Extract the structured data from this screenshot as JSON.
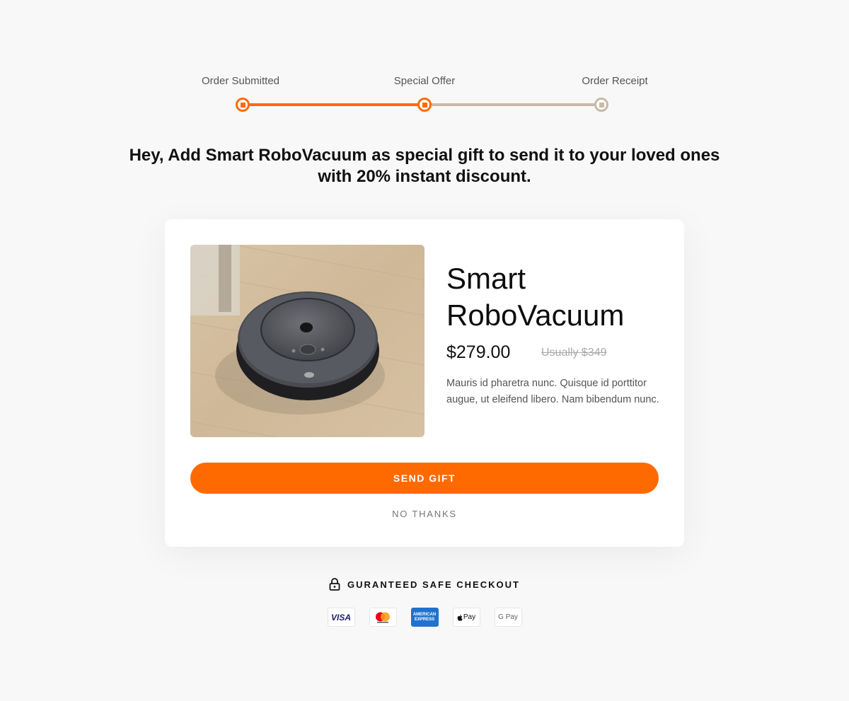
{
  "stepper": {
    "steps": [
      {
        "label": "Order Submitted",
        "state": "done"
      },
      {
        "label": "Special Offer",
        "state": "current"
      },
      {
        "label": "Order Receipt",
        "state": "pending"
      }
    ]
  },
  "headline": "Hey, Add Smart RoboVacuum as special gift to send it to your loved ones with 20% instant discount.",
  "product": {
    "title": "Smart RoboVacuum",
    "price": "$279.00",
    "old_price": "Usually $349",
    "description": "Mauris id pharetra nunc. Quisque id porttitor augue, ut eleifend libero. Nam bibendum nunc.",
    "image_icon": "robot-vacuum-photo"
  },
  "actions": {
    "send_label": "SEND GIFT",
    "decline_label": "NO THANKS"
  },
  "checkout": {
    "safe_label": "GURANTEED SAFE CHECKOUT",
    "icon": "lock-icon"
  },
  "payment_methods": {
    "visa": "VISA",
    "amex": "AMERICAN EXPRESS",
    "apple": "Pay",
    "gpay": "G Pay"
  },
  "colors": {
    "accent": "#ff6a00",
    "pending": "#c9b9a8",
    "background": "#f8f8f8"
  }
}
